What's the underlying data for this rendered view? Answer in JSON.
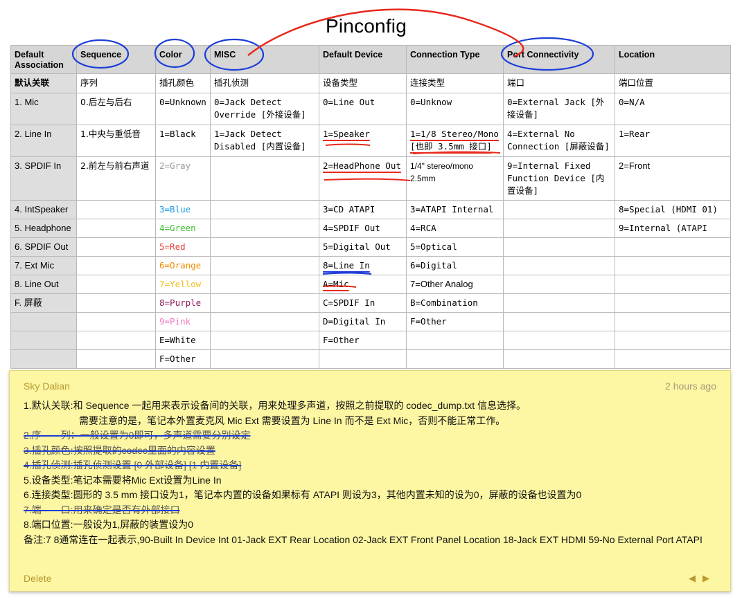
{
  "title": "Pinconfig",
  "table": {
    "headers": [
      "Default Association",
      "Sequence",
      "Color",
      "MISC",
      "Default Device",
      "Connection Type",
      "Port Connectivity",
      "Location"
    ],
    "rows": [
      [
        "默认关联",
        "序列",
        "插孔颜色",
        "插孔侦测",
        "设备类型",
        "连接类型",
        "端口",
        "端口位置"
      ],
      [
        "1. Mic",
        "0.后左与后右",
        "0=Unknown",
        "0=Jack Detect Override [外接设备]",
        "0=Line Out",
        "0=Unknow",
        "0=External Jack [外接设备]",
        "0=N/A"
      ],
      [
        "2. Line In",
        "1.中央与重低音",
        "1=Black",
        "1=Jack Detect Disabled [内置设备]",
        "1=Speaker",
        "1=1/8 Stereo/Mono [也即 3.5mm 接口]",
        "4=External No Connection [屏蔽设备]",
        "1=Rear"
      ],
      [
        "3. SPDIF In",
        "2.前左与前右声道",
        "2=Gray",
        "",
        "2=HeadPhone Out",
        "1/4\" stereo/mono 2.5mm",
        "9=Internal Fixed Function Device [内置设备]",
        "2=Front"
      ],
      [
        "4. IntSpeaker",
        "",
        "3=Blue",
        "",
        "3=CD ATAPI",
        "3=ATAPI Internal",
        "",
        "8=Special (HDMI 01)"
      ],
      [
        "5. Headphone",
        "",
        "4=Green",
        "",
        "4=SPDIF Out",
        "4=RCA",
        "",
        "9=Internal (ATAPI"
      ],
      [
        "6. SPDIF Out",
        "",
        "5=Red",
        "",
        "5=Digital Out",
        "5=Optical",
        "",
        ""
      ],
      [
        "7. Ext Mic",
        "",
        "6=Orange",
        "",
        "8=Line In",
        "6=Digital",
        "",
        ""
      ],
      [
        "8. Line Out",
        "",
        "7=Yellow",
        "",
        "A=Mic",
        "7=Other Analog",
        "",
        ""
      ],
      [
        "F. 屏蔽",
        "",
        "8=Purple",
        "",
        "C=SPDIF In",
        "B=Combination",
        "",
        ""
      ],
      [
        "",
        "",
        "9=Pink",
        "",
        "D=Digital In",
        "F=Other",
        "",
        ""
      ],
      [
        "",
        "",
        "E=White",
        "",
        "F=Other",
        "",
        "",
        ""
      ],
      [
        "",
        "",
        "F=Other",
        "",
        "",
        "",
        "",
        ""
      ]
    ],
    "color_values": {
      "2=Gray": "#9a9a9a",
      "3=Blue": "#1a9be0",
      "4=Green": "#3bbd2a",
      "5=Red": "#e5413a",
      "6=Orange": "#f08a00",
      "7=Yellow": "#efc21c",
      "8=Purple": "#8a1a5a",
      "9=Pink": "#ef7bc0"
    }
  },
  "note": {
    "author": "Sky Dalian",
    "time": "2 hours ago",
    "lines": [
      "1.默认关联:和 Sequence 一起用来表示设备间的关联，用来处理多声道，按照之前提取的 codec_dump.txt 信息选择。",
      "需要注意的是，笔记本外置麦克风 Mic Ext 需要设置为 Line In 而不是 Ext Mic，否则不能正常工作。",
      "2.序　　列：一般设置为0即可，多声道需要分别设定",
      "3.插孔颜色:按照提取的codec里面的内容设置",
      "4.插孔侦测:插孔侦测设置 [0 外部设备] [1 内置设备]",
      "5.设备类型:笔记本需要将Mic Ext设置为Line In",
      "6.连接类型:圆形的 3.5 mm 接口设为1，笔记本内置的设备如果标有 ATAPI 则设为3，其他内置未知的设为0，屏蔽的设备也设置为0",
      "7.端　　口:用来确定是否有外部接口",
      "8.端口位置:一般设为1,屏蔽的装置设为0",
      "备注:7 8通常连在一起表示,90-Built In Device Int 01-Jack EXT Rear Location 02-Jack EXT Front Panel Location 18-Jack EXT HDMI 59-No External Port ATAPI"
    ],
    "delete_label": "Delete",
    "prev_arrow": "◀",
    "next_arrow": "▶"
  },
  "annotation_colors": {
    "red": "#e8281b",
    "blue": "#1c3dd8"
  }
}
